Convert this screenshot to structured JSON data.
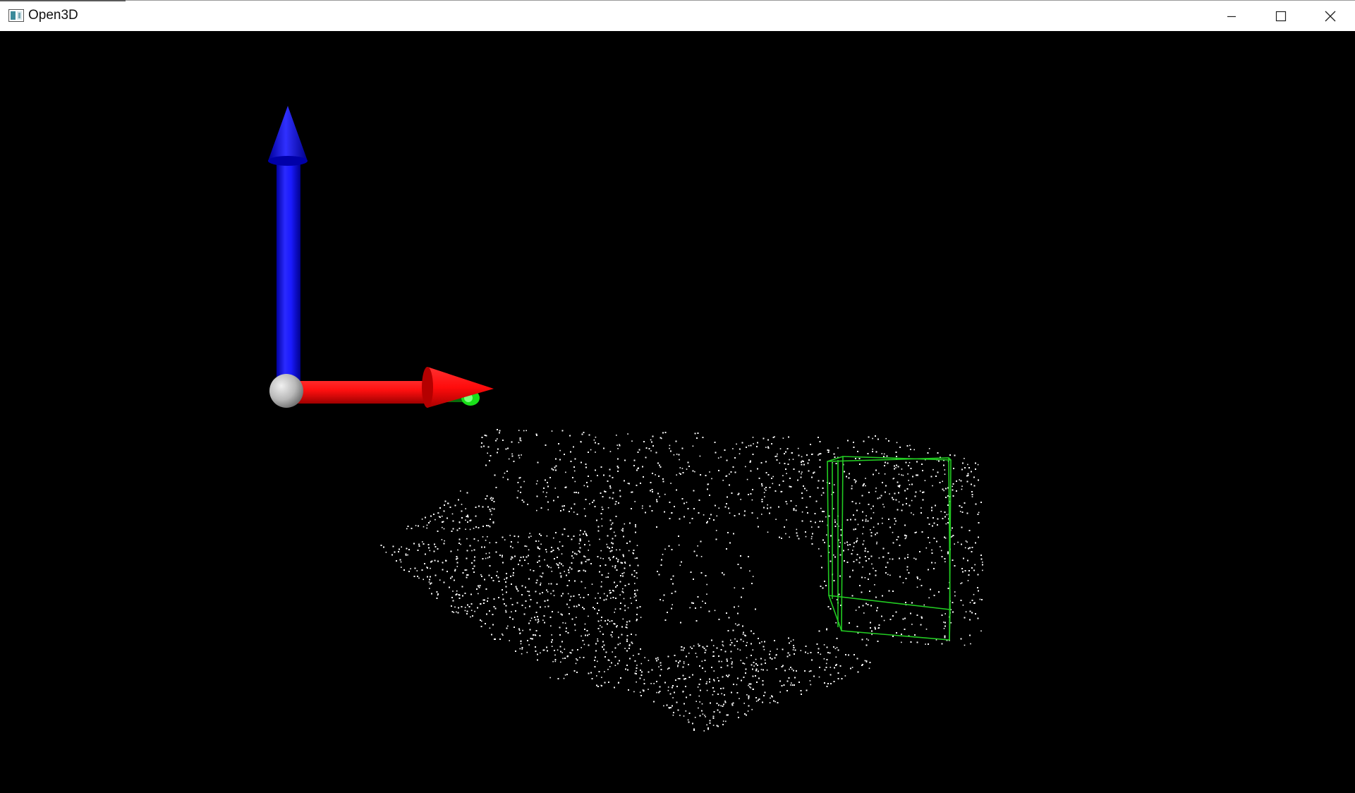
{
  "window": {
    "title": "Open3D",
    "icon": "open3d-app-icon",
    "controls": {
      "minimize_icon": "minimize-icon",
      "maximize_icon": "maximize-icon",
      "close_icon": "close-icon"
    }
  },
  "scene": {
    "background_color": "#000000",
    "point_color": "#ffffff",
    "bounding_box_color": "#22cc22",
    "axes": {
      "x_color": "#ff1010",
      "y_color": "#20dd20",
      "z_color": "#1010ff",
      "origin_color": "#c8c8c8"
    }
  }
}
